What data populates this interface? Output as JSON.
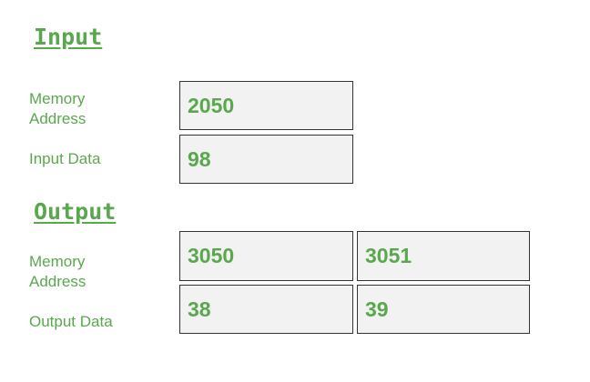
{
  "input": {
    "title": "Input",
    "memory_label_line1": "Memory",
    "memory_label_line2": "Address",
    "data_label": "Input Data",
    "memory_address": "2050",
    "data_value": "98"
  },
  "output": {
    "title": "Output",
    "memory_label_line1": "Memory",
    "memory_label_line2": "Address",
    "data_label": "Output Data",
    "memory_addresses": [
      "3050",
      "3051"
    ],
    "data_values": [
      "38",
      "39"
    ]
  },
  "colors": {
    "text_green": "#5aa84d",
    "box_fill": "#f2f2f2",
    "box_border": "#333333"
  }
}
